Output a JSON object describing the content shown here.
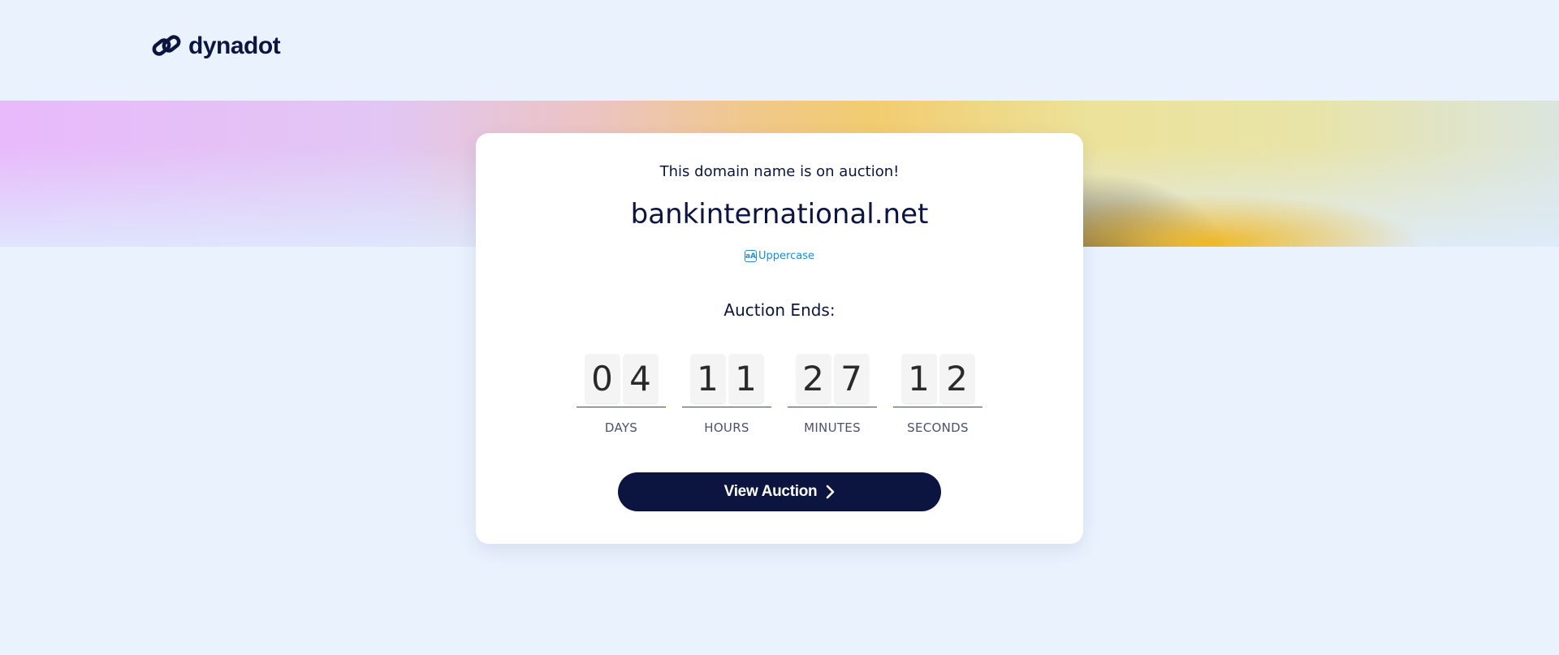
{
  "header": {
    "brand_name": "dynadot",
    "logo_icon": "link-chain-icon",
    "brand_color": "#0b1540"
  },
  "card": {
    "subtitle": "This domain name is on auction!",
    "domain_name": "bankinternational.net",
    "uppercase_icon_text": "aA",
    "uppercase_label": "Uppercase",
    "auction_ends_label": "Auction Ends:",
    "countdown": [
      {
        "digits": [
          "0",
          "4"
        ],
        "label": "DAYS"
      },
      {
        "digits": [
          "1",
          "1"
        ],
        "label": "HOURS"
      },
      {
        "digits": [
          "2",
          "7"
        ],
        "label": "MINUTES"
      },
      {
        "digits": [
          "1",
          "2"
        ],
        "label": "SECONDS"
      }
    ],
    "view_button_label": "View Auction",
    "view_button_icon": "chevron-right-icon"
  },
  "colors": {
    "page_background": "#eaf2fe",
    "button_background": "#0b1540",
    "link_color": "#1a8fd6",
    "underline_color": "#3a39b5"
  }
}
